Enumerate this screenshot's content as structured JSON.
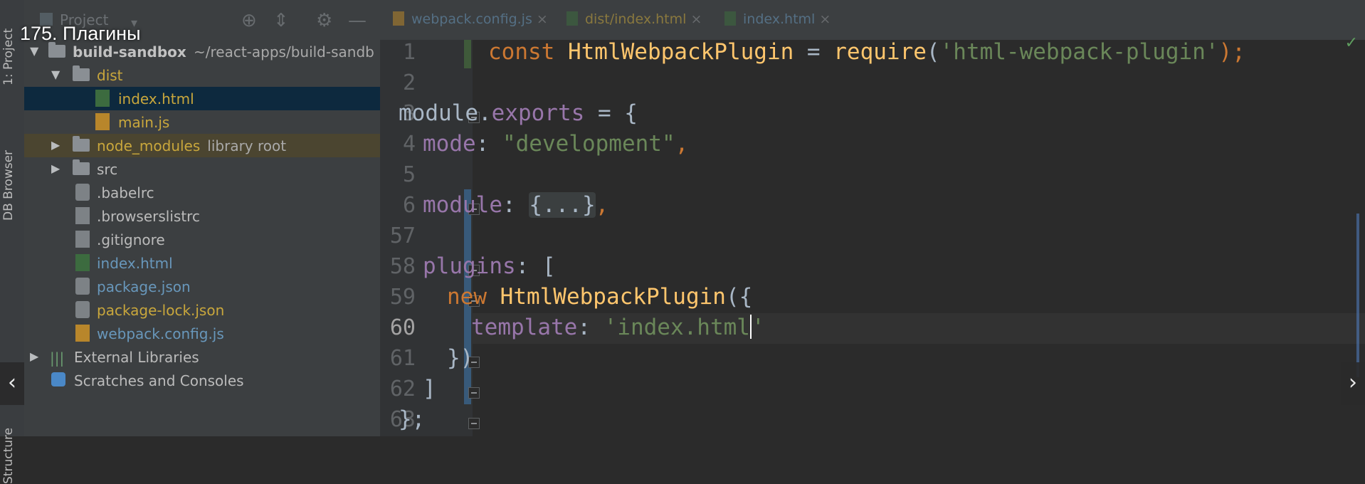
{
  "overlay": {
    "title": "175. Плагины",
    "prev_label": "‹",
    "next_label": "›"
  },
  "tool_stripe": {
    "project_tab": "1: Project",
    "db_browser_tab": "DB Browser",
    "structure_tab": "Structure"
  },
  "project_panel": {
    "title": "Project",
    "root": {
      "name": "build-sandbox",
      "path": "~/react-apps/build-sandb"
    },
    "items": [
      {
        "label": "dist",
        "kind": "folder",
        "level": 1,
        "expanded": true
      },
      {
        "label": "index.html",
        "kind": "html",
        "level": 2,
        "selected": true
      },
      {
        "label": "main.js",
        "kind": "js",
        "level": 2
      },
      {
        "label": "node_modules",
        "sub": "library root",
        "kind": "folder",
        "level": 1,
        "expanded": false
      },
      {
        "label": "src",
        "kind": "folder",
        "level": 1,
        "expanded": false
      },
      {
        "label": ".babelrc",
        "kind": "config",
        "level": 1
      },
      {
        "label": ".browserslistrc",
        "kind": "text",
        "level": 1
      },
      {
        "label": ".gitignore",
        "kind": "text",
        "level": 1
      },
      {
        "label": "index.html",
        "kind": "html",
        "level": 1
      },
      {
        "label": "package.json",
        "kind": "config",
        "level": 1
      },
      {
        "label": "package-lock.json",
        "kind": "config",
        "level": 1
      },
      {
        "label": "webpack.config.js",
        "kind": "js",
        "level": 1
      },
      {
        "label": "External Libraries",
        "kind": "libraries",
        "level": 0
      },
      {
        "label": "Scratches and Consoles",
        "kind": "scratches",
        "level": 0
      }
    ]
  },
  "editor": {
    "tabs": [
      {
        "label": "webpack.config.js",
        "active": true
      },
      {
        "label": "dist/index.html",
        "active": false
      },
      {
        "label": "index.html",
        "active": false
      }
    ],
    "line_numbers": [
      "1",
      "2",
      "3",
      "4",
      "5",
      "6",
      "57",
      "58",
      "59",
      "60",
      "61",
      "62",
      "63"
    ],
    "current_line": "60",
    "code": {
      "l1_const": "const ",
      "l1_name": "HtmlWebpackPlugin",
      "l1_eq": " = ",
      "l1_req": "require",
      "l1_open": "(",
      "l1_str": "'html-webpack-plugin'",
      "l1_close": ");",
      "l3_module": "module.",
      "l3_exports": "exports",
      "l3_rest": " = {",
      "l4_key": "mode",
      "l4_colon": ": ",
      "l4_str": "\"development\"",
      "l4_comma": ",",
      "l6_key": "module",
      "l6_colon": ": ",
      "l6_folded": "{...}",
      "l6_comma": ",",
      "l58_key": "plugins",
      "l58_rest": ": [",
      "l59_new": "new ",
      "l59_name": "HtmlWebpackPlugin",
      "l59_rest": "({",
      "l60_key": "template",
      "l60_colon": ": ",
      "l60_str_a": "'index.html",
      "l60_str_b": "'",
      "l61": "})",
      "l62": "]",
      "l63": "};"
    }
  },
  "colors": {
    "keyword": "#cc7832",
    "function": "#ffc66d",
    "string": "#6a8759",
    "property": "#9876aa",
    "text": "#a9b7c6",
    "folder_yellow": "#c9a73c",
    "file_blue": "#6897bb",
    "selection": "#0d293e"
  }
}
